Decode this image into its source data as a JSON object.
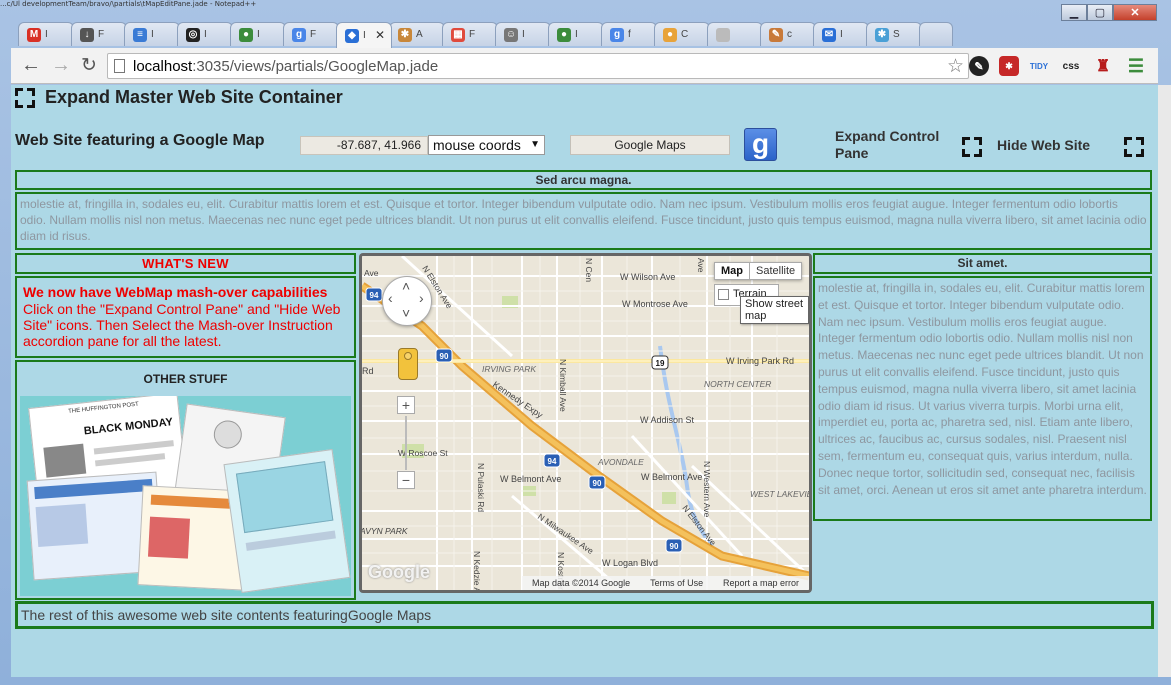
{
  "window": {
    "title_strip": "...c/Ul developmentTeam/bravo/\\partials\\tMapEditPane.jade - Notepad++"
  },
  "tabs": [
    {
      "label": "I",
      "color": "#d93025",
      "glyph": "M"
    },
    {
      "label": "F",
      "color": "#555555",
      "glyph": "↓"
    },
    {
      "label": "I",
      "color": "#3a7bd5",
      "glyph": "≡"
    },
    {
      "label": "I",
      "color": "#222222",
      "glyph": "◎"
    },
    {
      "label": "I",
      "color": "#3c8c3c",
      "glyph": "●"
    },
    {
      "label": "F",
      "color": "#4a86e8",
      "glyph": "g"
    },
    {
      "label": "I",
      "color": "#2a6fd6",
      "glyph": "◆",
      "active": true
    },
    {
      "label": "A",
      "color": "#c8873a",
      "glyph": "✱"
    },
    {
      "label": "F",
      "color": "#e04a3c",
      "glyph": "▦"
    },
    {
      "label": "I",
      "color": "#777777",
      "glyph": "☺"
    },
    {
      "label": "I",
      "color": "#3c8c3c",
      "glyph": "●"
    },
    {
      "label": "f",
      "color": "#4a86e8",
      "glyph": "g"
    },
    {
      "label": "C",
      "color": "#e8a33a",
      "glyph": "●"
    },
    {
      "label": "",
      "color": "#bbbbbb",
      "glyph": ""
    },
    {
      "label": "c",
      "color": "#c87a3a",
      "glyph": "✎"
    },
    {
      "label": "I",
      "color": "#2a6fd6",
      "glyph": "✉"
    },
    {
      "label": "S",
      "color": "#4aa0d6",
      "glyph": "✱"
    }
  ],
  "toolbar": {
    "url_host": "localhost",
    "url_rest": ":3035/views/partials/GoogleMap.jade",
    "ext_tidy": "TIDY",
    "ext_css": "css"
  },
  "page": {
    "header_title": "Expand Master Web Site Container",
    "site_title": "Web Site featuring a Google Map",
    "coords_value": "-87.687, 41.966",
    "coords_select": "mouse coords",
    "gmaps_button": "Google Maps",
    "g_logo": "g",
    "expand_pane": "Expand Control Pane",
    "hide_site": "Hide Web Site"
  },
  "banner": {
    "heading": "Sed arcu magna.",
    "body": "molestie at, fringilla in, sodales eu, elit. Curabitur mattis lorem et est. Quisque et tortor. Integer bibendum vulputate odio. Nam nec ipsum. Vestibulum mollis eros feugiat augue. Integer fermentum odio lobortis odio. Nullam mollis nisl non metus. Maecenas nec nunc eget pede ultrices blandit. Ut non purus ut elit convallis eleifend. Fusce tincidunt, justo quis tempus euismod, magna nulla viverra libero, sit amet lacinia odio diam id risus."
  },
  "whats_new": {
    "heading": "WHAT'S NEW",
    "headline": "We now have WebMap mash-over capabilities",
    "text": "Click on the \"Expand Control Pane\" and \"Hide Web Site\" icons. Then Select the Mash-over Instruction accordion pane for all the latest."
  },
  "other_stuff": {
    "heading": "OTHER STUFF",
    "collage_paper": "THE HUFFINGTON POST",
    "collage_headline": "BLACK MONDAY"
  },
  "map": {
    "type_map": "Map",
    "type_satellite": "Satellite",
    "terrain": "Terrain",
    "tooltip": "Show street map",
    "attribution": "Map data ©2014 Google",
    "terms": "Terms of Use",
    "report": "Report a map error",
    "google_watermark": "Google",
    "labels": [
      {
        "text": "W Wilson Ave"
      },
      {
        "text": "W Montrose Ave"
      },
      {
        "text": "W Irving Park Rd"
      },
      {
        "text": "IRVING PARK"
      },
      {
        "text": "NORTH CENTER"
      },
      {
        "text": "W Addison St"
      },
      {
        "text": "W Roscoe St"
      },
      {
        "text": "AVONDALE"
      },
      {
        "text": "W Belmont Ave"
      },
      {
        "text": "W Belmont Ave"
      },
      {
        "text": "WEST LAKEVIEW"
      },
      {
        "text": "W Logan Blvd"
      },
      {
        "text": "Kennedy Expy"
      },
      {
        "text": "N Elston Ave"
      },
      {
        "text": "N Milwaukee Ave"
      },
      {
        "text": "N Kimball Ave"
      },
      {
        "text": "N Pulaski Rd"
      },
      {
        "text": "N Western Ave"
      },
      {
        "text": "N Kedzie Ave"
      },
      {
        "text": "N Elston Ave"
      },
      {
        "text": "Rd"
      },
      {
        "text": "AVYN PARK"
      },
      {
        "text": "N Kostner"
      },
      {
        "text": "N Cen"
      },
      {
        "text": "Ave"
      },
      {
        "text": "Ave"
      }
    ],
    "shields": [
      "94",
      "90",
      "94",
      "90",
      "90",
      "19"
    ]
  },
  "sit_amet": {
    "heading": "Sit amet.",
    "body": "molestie at, fringilla in, sodales eu, elit. Curabitur mattis lorem et est. Quisque et tortor. Integer bibendum vulputate odio. Nam nec ipsum. Vestibulum mollis eros feugiat augue. Integer fermentum odio lobortis odio. Nullam mollis nisl non metus. Maecenas nec nunc eget pede ultrices blandit. Ut non purus ut elit convallis eleifend. Fusce tincidunt, justo quis tempus euismod, magna nulla viverra libero, sit amet lacinia odio diam id risus. Ut varius viverra turpis. Morbi urna elit, imperdiet eu, porta ac, pharetra sed, nisl. Etiam ante libero, ultrices ac, faucibus ac, cursus sodales, nisl. Praesent nisl sem, fermentum eu, consequat quis, varius interdum, nulla. Donec neque tortor, sollicitudin sed, consequat nec, facilisis sit amet, orci. Aenean ut eros sit amet ante pharetra interdum."
  },
  "footer": {
    "text": "The rest of this awesome web site contents featuringGoogle Maps"
  }
}
